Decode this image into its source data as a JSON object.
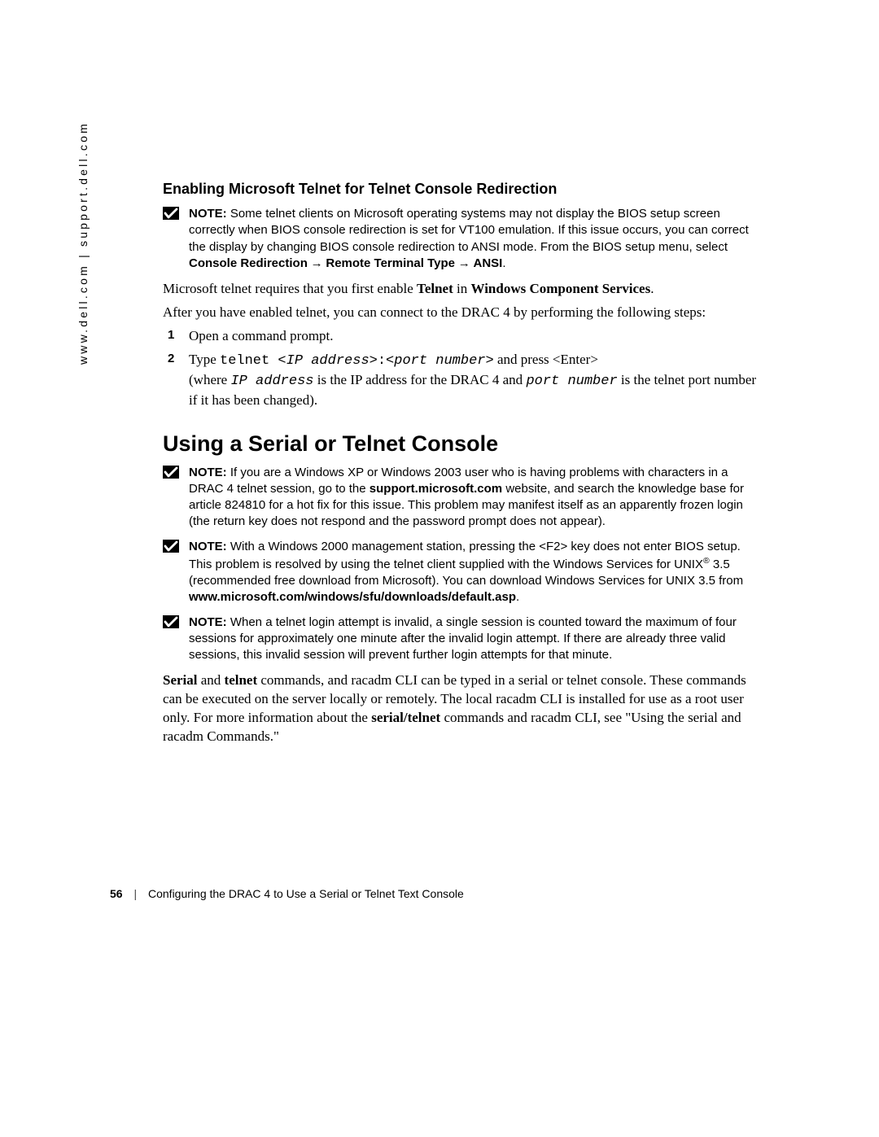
{
  "sidebar": {
    "url": "www.dell.com | support.dell.com"
  },
  "section1": {
    "title": "Enabling Microsoft Telnet for Telnet Console Redirection",
    "note1": {
      "label": "NOTE:",
      "text_a": " Some telnet clients on Microsoft operating systems may not display the BIOS setup screen correctly when BIOS console redirection is set for VT100 emulation. If this issue occurs, you can correct the display by changing BIOS console redirection to ANSI mode. From the BIOS setup menu, select ",
      "path1": "Console Redirection",
      "arrow": " → ",
      "path2": "Remote Terminal Type",
      "path3": "ANSI",
      "period": "."
    },
    "p1_a": "Microsoft telnet requires that you first enable ",
    "p1_b": "Telnet",
    "p1_c": " in ",
    "p1_d": "Windows Component Services",
    "p1_e": ".",
    "p2": "After you have enabled telnet, you can connect to the DRAC 4 by performing the following steps:",
    "list": {
      "n1": "1",
      "i1": "Open a command prompt.",
      "n2": "2",
      "i2_a": "Type ",
      "i2_cmd1": "telnet <",
      "i2_cmd2": "IP address",
      "i2_cmd3": ">:<",
      "i2_cmd4": "port number",
      "i2_cmd5": ">",
      "i2_b": " and press <Enter>",
      "i2_c": "(where ",
      "i2_ip": "IP address",
      "i2_d": " is the IP address for the DRAC 4 and ",
      "i2_pn": "port number",
      "i2_e": " is the telnet port number if it has been changed)."
    }
  },
  "section2": {
    "title": "Using a Serial or Telnet Console",
    "note1": {
      "label": "NOTE:",
      "a": " If you are a Windows XP or Windows 2003 user who is having problems with characters in a DRAC 4 telnet session, go to the ",
      "link": "support.microsoft.com",
      "b": " website, and search the knowledge base for article 824810 for a hot fix for this issue. This problem may manifest itself as an apparently frozen login (the return key does not respond and the password prompt does not appear)."
    },
    "note2": {
      "label": "NOTE:",
      "a": " With a Windows 2000 management station, pressing the <F2> key does not enter BIOS setup. This problem is resolved by using the telnet client supplied with the Windows Services for UNIX",
      "reg": "®",
      "b": " 3.5 (recommended free download from Microsoft). You can download Windows Services for UNIX 3.5 from ",
      "link": "www.microsoft.com/windows/sfu/downloads/default.asp",
      "c": "."
    },
    "note3": {
      "label": "NOTE:",
      "a": " When a telnet login attempt is invalid, a single session is counted toward the maximum of four sessions for approximately one minute after the invalid login attempt. If there are already three valid sessions, this invalid session will prevent further login attempts for that minute."
    },
    "p1_a": "Serial",
    "p1_b": " and ",
    "p1_c": "telnet",
    "p1_d": " commands, and racadm CLI can be typed in a serial or telnet console. These commands can be executed on the server locally or remotely. The local racadm CLI is installed for use as a root user only. For more information about the ",
    "p1_e": "serial/telnet",
    "p1_f": " commands and racadm CLI, see \"Using the serial and racadm Commands.\""
  },
  "footer": {
    "page": "56",
    "sep": "|",
    "title": "Configuring the DRAC 4 to Use a Serial or Telnet Text Console"
  }
}
